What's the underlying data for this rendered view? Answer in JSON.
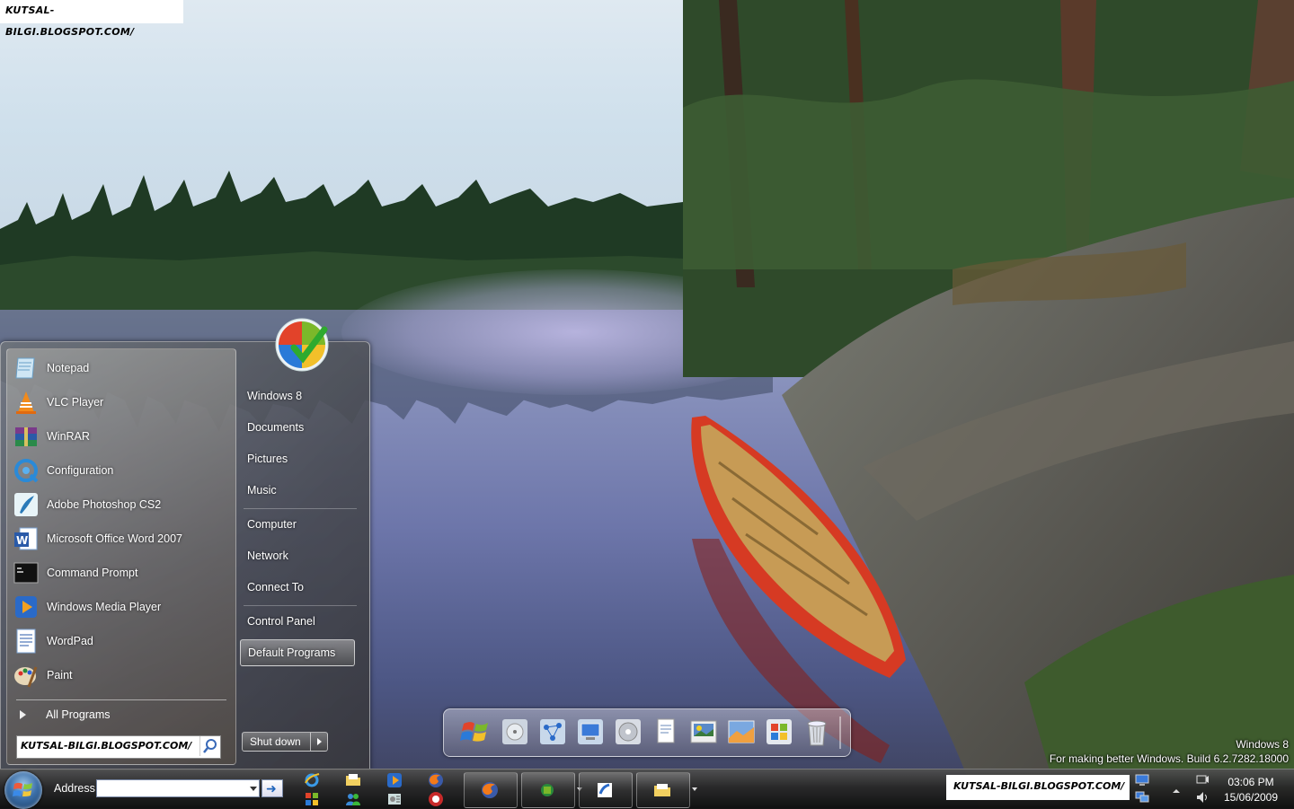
{
  "watermark": {
    "text": "KUTSAL-BILGI.BLOGSPOT.COM/"
  },
  "desktop": {
    "build_info": {
      "line1": "Windows 8",
      "line2": "For making better Windows. Build 6.2.7282.18000"
    }
  },
  "start_menu": {
    "programs": [
      {
        "label": "Notepad",
        "icon": "notepad-icon"
      },
      {
        "label": "VLC Player",
        "icon": "vlc-icon"
      },
      {
        "label": "WinRAR",
        "icon": "winrar-icon"
      },
      {
        "label": "Configuration",
        "icon": "configuration-icon"
      },
      {
        "label": "Adobe Photoshop CS2",
        "icon": "photoshop-icon"
      },
      {
        "label": "Microsoft Office Word 2007",
        "icon": "word-icon"
      },
      {
        "label": "Command Prompt",
        "icon": "command-prompt-icon"
      },
      {
        "label": "Windows Media Player",
        "icon": "media-player-icon"
      },
      {
        "label": "WordPad",
        "icon": "wordpad-icon"
      },
      {
        "label": "Paint",
        "icon": "paint-icon"
      }
    ],
    "all_programs": "All Programs",
    "search_watermark": "KUTSAL-BILGI.BLOGSPOT.COM/",
    "right": {
      "items": [
        {
          "label": "Windows 8"
        },
        {
          "label": "Documents"
        },
        {
          "label": "Pictures"
        },
        {
          "label": "Music"
        },
        {
          "label": "Computer"
        },
        {
          "label": "Network"
        },
        {
          "label": "Connect To"
        },
        {
          "label": "Control Panel"
        },
        {
          "label": "Default Programs"
        }
      ],
      "selected": "Default Programs"
    },
    "shutdown_label": "Shut down"
  },
  "dock": {
    "icons": [
      "windows-logo-icon",
      "disc-drive-icon",
      "network-icon",
      "display-icon",
      "dvd-icon",
      "document-icon",
      "photo-viewer-icon",
      "pictures-icon",
      "windows-flag-icon",
      "recycle-bin-icon"
    ]
  },
  "taskbar": {
    "address_label": "Address",
    "address_value": "",
    "quick_launch": [
      "internet-explorer-icon",
      "folder-icon",
      "media-player-icon",
      "firefox-icon",
      "controls-icon",
      "users-icon",
      "settings-icon",
      "firefox-alt-icon"
    ],
    "buttons": [
      "firefox-icon",
      "network-icon",
      "browser-icon",
      "folder-icon"
    ],
    "watermark": "KUTSAL-BILGI.BLOGSPOT.COM/",
    "clock": {
      "time": "03:06 PM",
      "date": "15/06/2009"
    }
  }
}
